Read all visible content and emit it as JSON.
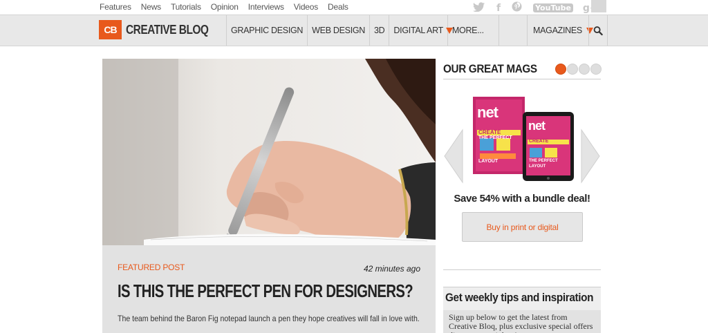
{
  "top_links": [
    "Features",
    "News",
    "Tutorials",
    "Opinion",
    "Interviews",
    "Videos",
    "Deals"
  ],
  "social_icons": [
    "twitter-icon",
    "facebook-icon",
    "pinterest-icon",
    "youtube-icon",
    "googleplus-icon"
  ],
  "social_labels": {
    "twitter": "🐦",
    "facebook": "f",
    "pinterest": "℗",
    "youtube": "YouTube",
    "googleplus": "g+"
  },
  "logo": {
    "badge": "CB",
    "text": "CREATIVE BLOQ"
  },
  "nav": {
    "items": [
      "GRAPHIC DESIGN",
      "WEB DESIGN",
      "3D",
      "DIGITAL ART",
      "MORE..."
    ],
    "magazines": "MAGAZINES"
  },
  "colors": {
    "accent": "#e8591c",
    "nav_bg": "#e8e8e8",
    "card_bg": "#e2e2e2"
  },
  "featured": {
    "label": "FEATURED POST",
    "time": "42 minutes ago",
    "headline": "IS THIS THE PERFECT PEN FOR DESIGNERS?",
    "excerpt": "The team behind the Baron Fig notepad launch a pen they hope creatives will fall in love with."
  },
  "sidebar": {
    "title": "OUR GREAT MAGS",
    "magazine_cover": {
      "brand": "net",
      "cover_line1": "CREATE",
      "cover_line2": "THE PERFECT",
      "cover_line3": "LAYOUT"
    },
    "save_text": "Save 54% with a bundle deal!",
    "buy_label": "Buy in print or digital",
    "weekly_title": "Get weekly tips and inspiration",
    "weekly_text": "Sign up below to get the latest from Creative Bloq, plus exclusive special offers direct to your inbox!"
  }
}
